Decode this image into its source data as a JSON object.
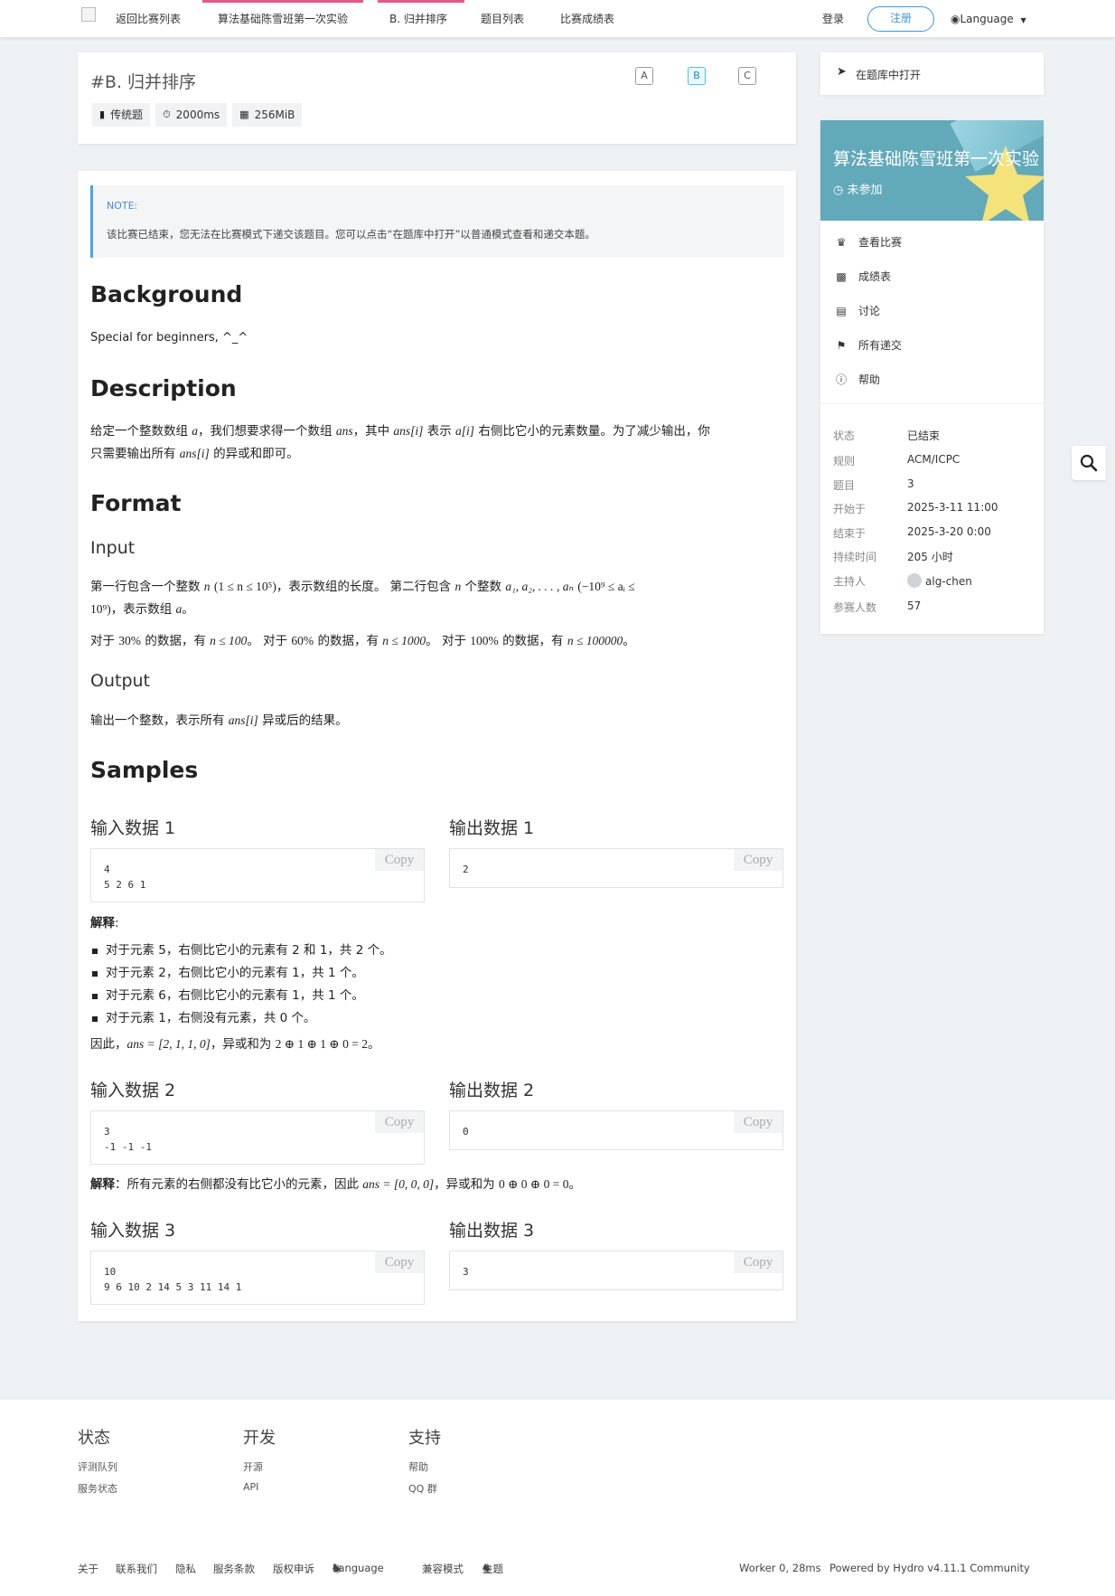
{
  "nav": {
    "back": "返回比赛列表",
    "contest": "算法基础陈雪班第一次实验",
    "problem": "B. 归并排序",
    "problems": "题目列表",
    "scoreboard": "比赛成绩表",
    "login": "登录",
    "register": "注册",
    "language": "Language"
  },
  "problem": {
    "title": "#B. 归并排序",
    "tags": [
      {
        "icon": "book-icon",
        "label": "传统题"
      },
      {
        "icon": "stopwatch-icon",
        "label": "2000ms"
      },
      {
        "icon": "memory-icon",
        "label": "256MiB"
      }
    ],
    "switch": [
      "A",
      "B",
      "C"
    ],
    "current": "B"
  },
  "note": {
    "title": "NOTE:",
    "text": "该比赛已结束，您无法在比赛模式下递交该题目。您可以点击“在题库中打开”以普通模式查看和递交本题。"
  },
  "sections": {
    "background": "Background",
    "background_text": "Special for beginners, ^_^",
    "description": "Description",
    "format": "Format",
    "input": "Input",
    "output": "Output",
    "output_text_a": "输出一个整数，表示所有",
    "output_text_b": "异或后的结果。",
    "samples": "Samples",
    "explain_label": "解释",
    "explain_colon": ":"
  },
  "description": {
    "l1a": "给定一个整数数组",
    "l1b": "，我们想要求得一个数组",
    "l1c": "，其中",
    "l1d": "表示",
    "l1e": "右侧比它小的元素数量。为了减少输出，你",
    "l2a": "只需要输出所有",
    "l2b": "的异或和即可。"
  },
  "input_text": {
    "l1a": "第一行包含一个整数",
    "l1b": "，表示数组的长度。 第二行包含",
    "l1c": "个整数",
    "l2b": "，表示数组",
    "l3a": "对于",
    "l3b": "的数据，有",
    "l3c": "。 对于",
    "l3d": "的数据，有",
    "l3e": "。 对于",
    "l3f": "的数据，有",
    "l3g": "。"
  },
  "samples": [
    {
      "in_label": "输入数据 1",
      "out_label": "输出数据 1",
      "input": "4\n5 2 6 1",
      "output": "2"
    },
    {
      "in_label": "输入数据 2",
      "out_label": "输出数据 2",
      "input": "3\n-1 -1 -1",
      "output": "0"
    },
    {
      "in_label": "输入数据 3",
      "out_label": "输出数据 3",
      "input": "10\n9 6 10 2 14 5 3 11 14 1",
      "output": "3"
    }
  ],
  "copy": "Copy",
  "explanation1": [
    "对于元素 5，右侧比它小的元素有 2 和 1，共 2 个。",
    "对于元素 2，右侧比它小的元素有 1，共 1 个。",
    "对于元素 6，右侧比它小的元素有 1，共 1 个。",
    "对于元素 1，右侧没有元素，共 0 个。"
  ],
  "explanation1_summary_a": "因此，",
  "explanation1_summary_b": "，异或和为",
  "explanation1_summary_c": "。",
  "explanation2_a": "：所有元素的右侧都没有比它小的元素，因此",
  "explanation2_b": "，异或和为",
  "explanation2_c": "。",
  "math": {
    "a": "a",
    "ans": "ans",
    "ans_i": "ans[i]",
    "a_i": "a[i]",
    "n": "n",
    "n_range": "(1 ≤ n ≤ 10⁵)",
    "a_seq": "a₁, a₂, . . . , aₙ",
    "a_range1": "(−10⁹ ≤ aᵢ ≤",
    "a_range2": "10⁹)",
    "p30": "30%",
    "c30": "n ≤ 100",
    "p60": "60%",
    "c60": "n ≤ 1000",
    "p100": "100%",
    "c100": "n ≤ 100000",
    "ans1": "ans = [2, 1, 1, 0]",
    "xor1": "2 ⊕ 1 ⊕ 1 ⊕ 0 = 2",
    "ans2": "ans = [0, 0, 0]",
    "xor2": "0 ⊕ 0 ⊕ 0 = 0"
  },
  "sidebar": {
    "open_in_bank": "在题库中打开",
    "contest_title": "算法基础陈雪班第一次实验",
    "status": "未参加",
    "menu": [
      {
        "icon": "trophy-icon",
        "label": "查看比赛"
      },
      {
        "icon": "bar-chart-icon",
        "label": "成绩表"
      },
      {
        "icon": "comment-icon",
        "label": "讨论"
      },
      {
        "icon": "flag-icon",
        "label": "所有递交"
      },
      {
        "icon": "help-icon",
        "label": "帮助"
      }
    ],
    "info": [
      {
        "k": "状态",
        "v": "已结束"
      },
      {
        "k": "规则",
        "v": "ACM/ICPC"
      },
      {
        "k": "题目",
        "v": "3"
      },
      {
        "k": "开始于",
        "v": "2025-3-11 11:00"
      },
      {
        "k": "结束于",
        "v": "2025-3-20 0:00"
      },
      {
        "k": "持续时间",
        "v": "205 小时"
      },
      {
        "k": "主持人",
        "v": "alg-chen"
      },
      {
        "k": "参赛人数",
        "v": "57"
      }
    ]
  },
  "footer": {
    "cols": [
      {
        "title": "状态",
        "links": [
          "评测队列",
          "服务状态"
        ]
      },
      {
        "title": "开发",
        "links": [
          "开源",
          "API"
        ]
      },
      {
        "title": "支持",
        "links": [
          "帮助",
          "QQ 群"
        ]
      }
    ],
    "bottom": [
      "关于",
      "联系我们",
      "隐私",
      "服务条款",
      "版权申诉"
    ],
    "language": "Language",
    "compat": "兼容模式",
    "theme": "主题",
    "worker": "Worker 0, 28ms",
    "powered": "Powered by Hydro v4.11.1 Community"
  },
  "colors": {
    "accent": "#e25a8a",
    "link": "#3a9ad9",
    "banner": "#62a9ba",
    "star": "#f4e27a"
  }
}
